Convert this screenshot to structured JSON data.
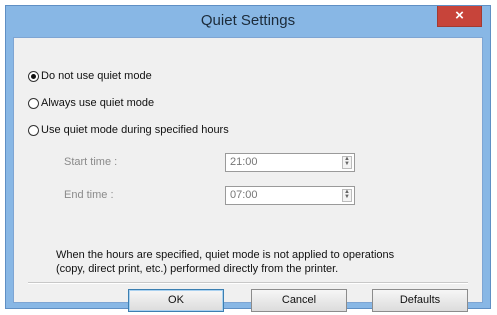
{
  "window": {
    "title": "Quiet Settings",
    "close_glyph": "×"
  },
  "options": [
    {
      "label": "Do not use quiet mode",
      "checked": true
    },
    {
      "label": "Always use quiet mode",
      "checked": false
    },
    {
      "label": "Use quiet mode during specified hours",
      "checked": false
    }
  ],
  "start_time": {
    "label": "Start time :",
    "value": "21:00"
  },
  "end_time": {
    "label": "End time :",
    "value": "07:00"
  },
  "note": {
    "line1": "When the hours are specified, quiet mode is not applied to operations",
    "line2": "(copy, direct print, etc.) performed directly from the printer."
  },
  "buttons": {
    "ok": "OK",
    "cancel": "Cancel",
    "defaults": "Defaults"
  }
}
